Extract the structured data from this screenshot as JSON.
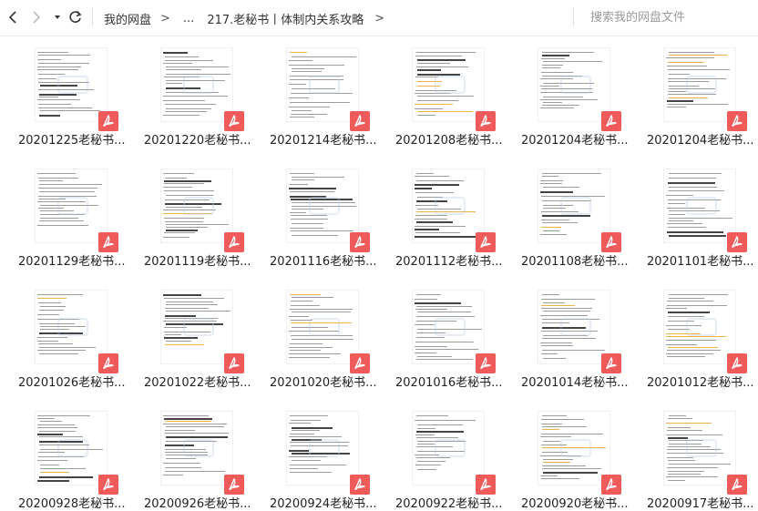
{
  "toolbar": {
    "back_icon": "chevron-left-icon",
    "forward_icon": "chevron-right-icon",
    "dropdown_icon": "caret-down-icon",
    "refresh_icon": "refresh-icon",
    "breadcrumb": [
      {
        "label": "我的网盘"
      },
      {
        "label": "..."
      },
      {
        "label": "217.老秘书丨体制内关系攻略"
      }
    ],
    "separator": ">",
    "search_placeholder": "搜索我的网盘文件"
  },
  "files": [
    {
      "name": "20201225老秘书..."
    },
    {
      "name": "20201220老秘书..."
    },
    {
      "name": "20201214老秘书..."
    },
    {
      "name": "20201208老秘书..."
    },
    {
      "name": "20201204老秘书..."
    },
    {
      "name": "20201204老秘书..."
    },
    {
      "name": "20201129老秘书..."
    },
    {
      "name": "20201119老秘书..."
    },
    {
      "name": "20201116老秘书..."
    },
    {
      "name": "20201112老秘书..."
    },
    {
      "name": "20201108老秘书..."
    },
    {
      "name": "20201101老秘书..."
    },
    {
      "name": "20201026老秘书..."
    },
    {
      "name": "20201022老秘书..."
    },
    {
      "name": "20201020老秘书..."
    },
    {
      "name": "20201016老秘书..."
    },
    {
      "name": "20201014老秘书..."
    },
    {
      "name": "20201012老秘书..."
    },
    {
      "name": "20200928老秘书..."
    },
    {
      "name": "20200926老秘书..."
    },
    {
      "name": "20200924老秘书..."
    },
    {
      "name": "20200922老秘书..."
    },
    {
      "name": "20200920老秘书..."
    },
    {
      "name": "20200917老秘书..."
    }
  ],
  "colors": {
    "pdf_badge": "#ef5a5a",
    "text": "#222222",
    "search_placeholder": "#9a9a9a"
  },
  "file_type_icon": "pdf-icon"
}
